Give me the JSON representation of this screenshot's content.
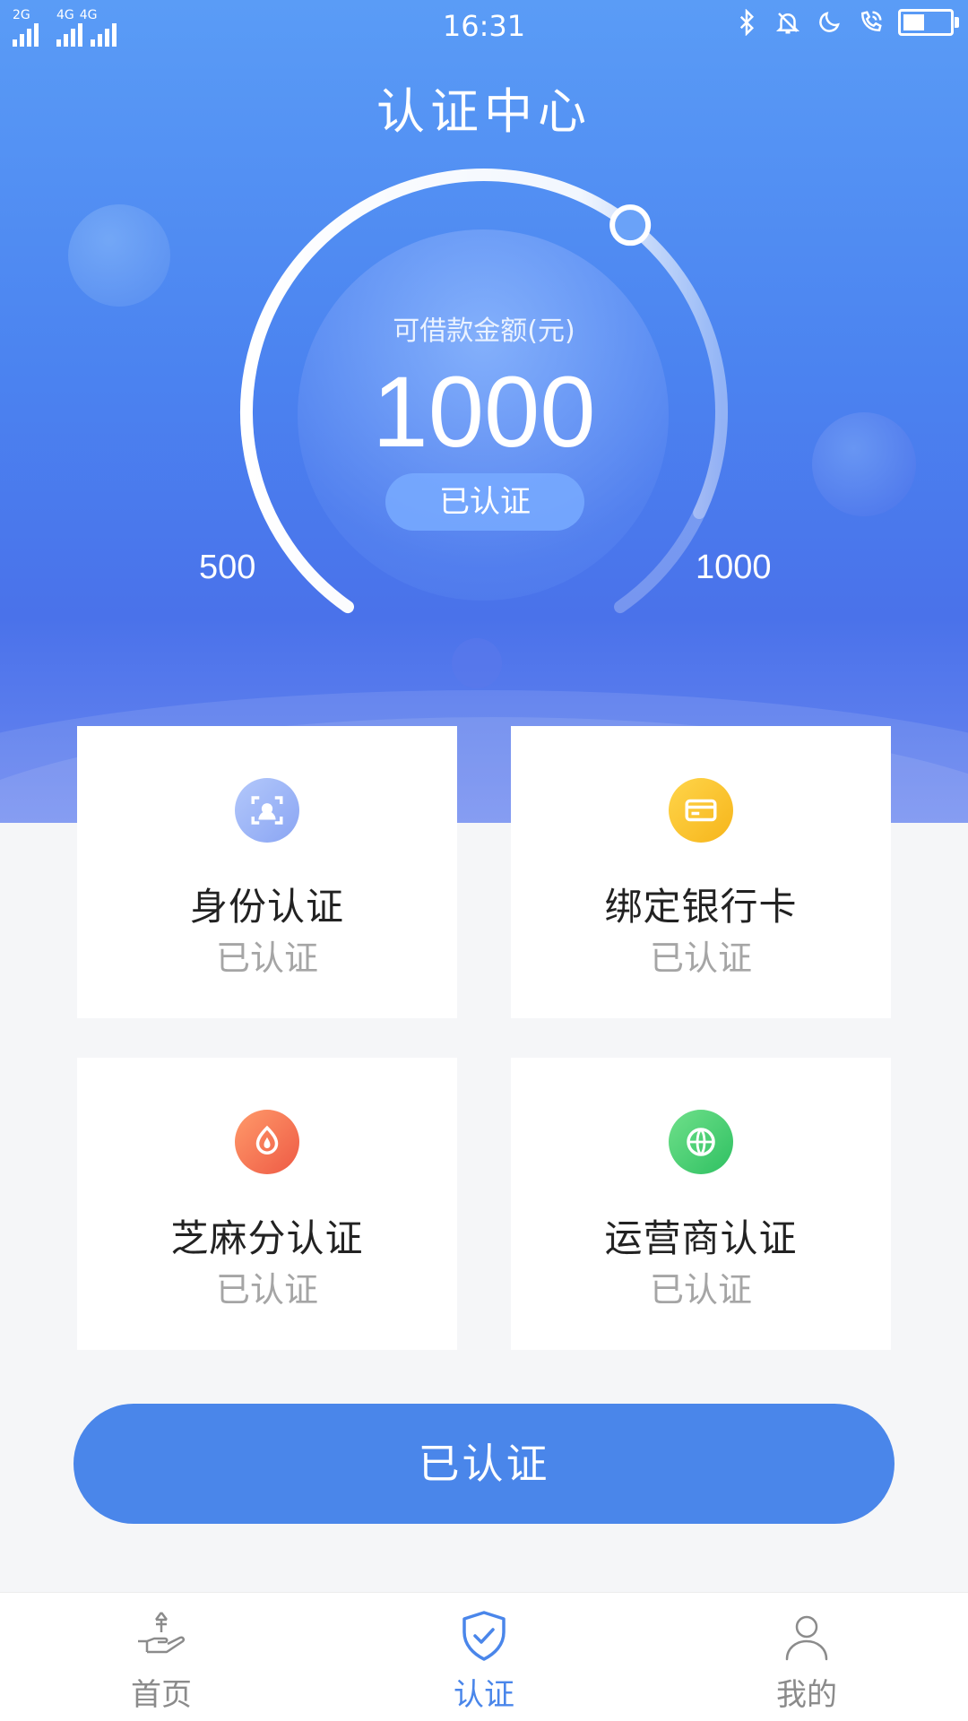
{
  "status_bar": {
    "signal1": "2G",
    "signal2": "4G",
    "signal3": "4G",
    "time": "16:31",
    "icons": [
      "bluetooth-icon",
      "bell-icon",
      "moon-icon",
      "wifi-call-icon",
      "battery-icon"
    ],
    "battery_level": 0.45
  },
  "header": {
    "title": "认证中心"
  },
  "gauge": {
    "label": "可借款金额(元)",
    "amount": "1000",
    "status": "已认证",
    "min": "500",
    "max": "1000"
  },
  "cards": [
    {
      "name": "身份认证",
      "status": "已认证",
      "icon": "id-scan-icon"
    },
    {
      "name": "绑定银行卡",
      "status": "已认证",
      "icon": "bank-card-icon"
    },
    {
      "name": "芝麻分认证",
      "status": "已认证",
      "icon": "sesame-icon"
    },
    {
      "name": "运营商认证",
      "status": "已认证",
      "icon": "globe-icon"
    }
  ],
  "main_button": {
    "label": "已认证"
  },
  "bottom_nav": [
    {
      "label": "首页",
      "icon": "home-money-icon"
    },
    {
      "label": "认证",
      "icon": "shield-check-icon",
      "active": true
    },
    {
      "label": "我的",
      "icon": "user-icon"
    }
  ],
  "colors": {
    "accent": "#4a86ea",
    "hero_top": "#5a9cf6",
    "hero_bottom": "#4a72ea",
    "card_icon_id": "#8aa5f3",
    "card_icon_bank": "#f6b51b",
    "card_icon_sesame": "#ee5a45",
    "card_icon_carrier": "#2fc062"
  }
}
